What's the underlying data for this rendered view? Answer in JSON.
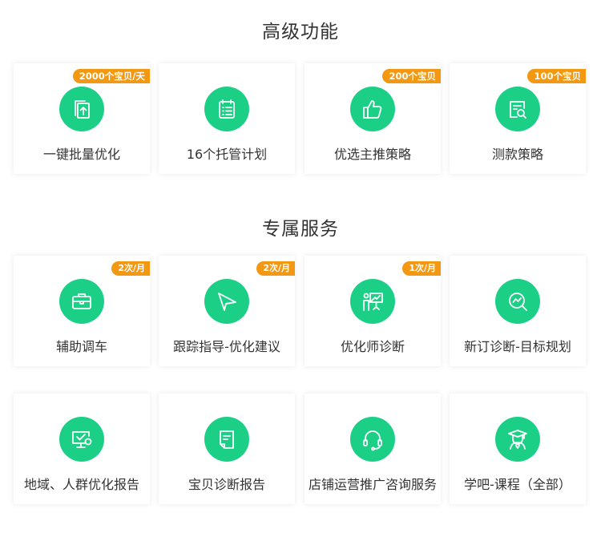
{
  "sections": [
    {
      "title": "高级功能",
      "cards": [
        {
          "label": "一键批量优化",
          "badge": "2000个宝贝/天",
          "icon": "copy-upload-icon"
        },
        {
          "label": "16个托管计划",
          "badge": "",
          "icon": "calendar-list-icon"
        },
        {
          "label": "优选主推策略",
          "badge": "200个宝贝",
          "icon": "thumbs-up-icon"
        },
        {
          "label": "测款策略",
          "badge": "100个宝贝",
          "icon": "search-document-icon"
        }
      ]
    },
    {
      "title": "专属服务",
      "cards": [
        {
          "label": "辅助调车",
          "badge": "2次/月",
          "icon": "briefcase-icon"
        },
        {
          "label": "跟踪指导-优化建议",
          "badge": "2次/月",
          "icon": "paper-plane-icon"
        },
        {
          "label": "优化师诊断",
          "badge": "1次/月",
          "icon": "presenter-board-icon"
        },
        {
          "label": "新订诊断-目标规划",
          "badge": "",
          "icon": "trend-search-icon"
        },
        {
          "label": "地域、人群优化报告",
          "badge": "",
          "icon": "monitor-check-icon"
        },
        {
          "label": "宝贝诊断报告",
          "badge": "",
          "icon": "report-document-icon"
        },
        {
          "label": "店铺运营推广咨询服务",
          "badge": "",
          "icon": "headset-icon"
        },
        {
          "label": "学吧-课程（全部）",
          "badge": "",
          "icon": "graduate-icon"
        }
      ]
    }
  ],
  "colors": {
    "accent": "#1ccf86",
    "badge": "#f39812",
    "text": "#333333"
  }
}
